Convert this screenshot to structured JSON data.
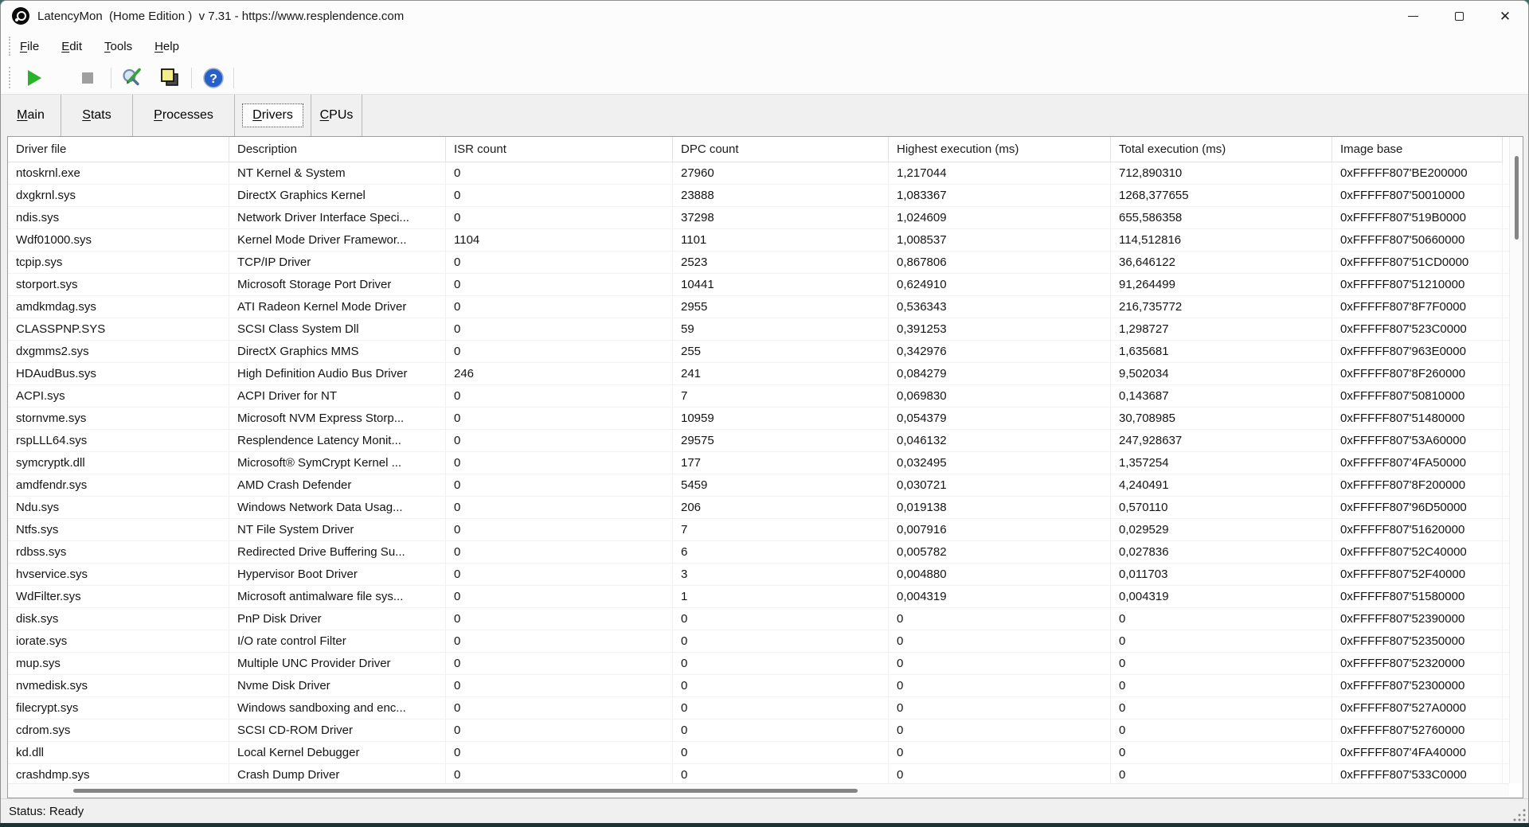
{
  "window": {
    "title": "LatencyMon  (Home Edition )  v 7.31 - https://www.resplendence.com"
  },
  "menu": {
    "items": [
      "File",
      "Edit",
      "Tools",
      "Help"
    ]
  },
  "toolbar": {
    "icons": {
      "play": "start-monitor",
      "stop": "stop-monitor",
      "options": "edit-options",
      "report": "copy-report",
      "help": "help"
    },
    "colors": {
      "play_green": "#28b428",
      "stop_gray": "#9f9f9f",
      "report_yellow": "#f2ec8c",
      "help_blue": "#2760c9"
    }
  },
  "tabs": [
    {
      "label": "Main",
      "active": false
    },
    {
      "label": "Stats",
      "active": false
    },
    {
      "label": "Processes",
      "active": false
    },
    {
      "label": "Drivers",
      "active": true
    },
    {
      "label": "CPUs",
      "active": false
    }
  ],
  "table": {
    "columns": [
      "Driver file",
      "Description",
      "ISR count",
      "DPC count",
      "Highest execution (ms)",
      "Total execution (ms)",
      "Image base"
    ],
    "rows": [
      [
        "ntoskrnl.exe",
        "NT Kernel & System",
        "0",
        "27960",
        "1,217044",
        "712,890310",
        "0xFFFFF807'BE200000"
      ],
      [
        "dxgkrnl.sys",
        "DirectX Graphics Kernel",
        "0",
        "23888",
        "1,083367",
        "1268,377655",
        "0xFFFFF807'50010000"
      ],
      [
        "ndis.sys",
        "Network Driver Interface Speci...",
        "0",
        "37298",
        "1,024609",
        "655,586358",
        "0xFFFFF807'519B0000"
      ],
      [
        "Wdf01000.sys",
        "Kernel Mode Driver Framewor...",
        "1104",
        "1101",
        "1,008537",
        "114,512816",
        "0xFFFFF807'50660000"
      ],
      [
        "tcpip.sys",
        "TCP/IP Driver",
        "0",
        "2523",
        "0,867806",
        "36,646122",
        "0xFFFFF807'51CD0000"
      ],
      [
        "storport.sys",
        "Microsoft Storage Port Driver",
        "0",
        "10441",
        "0,624910",
        "91,264499",
        "0xFFFFF807'51210000"
      ],
      [
        "amdkmdag.sys",
        "ATI Radeon Kernel Mode Driver",
        "0",
        "2955",
        "0,536343",
        "216,735772",
        "0xFFFFF807'8F7F0000"
      ],
      [
        "CLASSPNP.SYS",
        "SCSI Class System Dll",
        "0",
        "59",
        "0,391253",
        "1,298727",
        "0xFFFFF807'523C0000"
      ],
      [
        "dxgmms2.sys",
        "DirectX Graphics MMS",
        "0",
        "255",
        "0,342976",
        "1,635681",
        "0xFFFFF807'963E0000"
      ],
      [
        "HDAudBus.sys",
        "High Definition Audio Bus Driver",
        "246",
        "241",
        "0,084279",
        "9,502034",
        "0xFFFFF807'8F260000"
      ],
      [
        "ACPI.sys",
        "ACPI Driver for NT",
        "0",
        "7",
        "0,069830",
        "0,143687",
        "0xFFFFF807'50810000"
      ],
      [
        "stornvme.sys",
        "Microsoft NVM Express Storp...",
        "0",
        "10959",
        "0,054379",
        "30,708985",
        "0xFFFFF807'51480000"
      ],
      [
        "rspLLL64.sys",
        "Resplendence Latency Monit...",
        "0",
        "29575",
        "0,046132",
        "247,928637",
        "0xFFFFF807'53A60000"
      ],
      [
        "symcryptk.dll",
        "Microsoft® SymCrypt Kernel ...",
        "0",
        "177",
        "0,032495",
        "1,357254",
        "0xFFFFF807'4FA50000"
      ],
      [
        "amdfendr.sys",
        "AMD Crash Defender",
        "0",
        "5459",
        "0,030721",
        "4,240491",
        "0xFFFFF807'8F200000"
      ],
      [
        "Ndu.sys",
        "Windows Network Data Usag...",
        "0",
        "206",
        "0,019138",
        "0,570110",
        "0xFFFFF807'96D50000"
      ],
      [
        "Ntfs.sys",
        "NT File System Driver",
        "0",
        "7",
        "0,007916",
        "0,029529",
        "0xFFFFF807'51620000"
      ],
      [
        "rdbss.sys",
        "Redirected Drive Buffering Su...",
        "0",
        "6",
        "0,005782",
        "0,027836",
        "0xFFFFF807'52C40000"
      ],
      [
        "hvservice.sys",
        "Hypervisor Boot Driver",
        "0",
        "3",
        "0,004880",
        "0,011703",
        "0xFFFFF807'52F40000"
      ],
      [
        "WdFilter.sys",
        "Microsoft antimalware file sys...",
        "0",
        "1",
        "0,004319",
        "0,004319",
        "0xFFFFF807'51580000"
      ],
      [
        "disk.sys",
        "PnP Disk Driver",
        "0",
        "0",
        "0",
        "0",
        "0xFFFFF807'52390000"
      ],
      [
        "iorate.sys",
        "I/O rate control Filter",
        "0",
        "0",
        "0",
        "0",
        "0xFFFFF807'52350000"
      ],
      [
        "mup.sys",
        "Multiple UNC Provider Driver",
        "0",
        "0",
        "0",
        "0",
        "0xFFFFF807'52320000"
      ],
      [
        "nvmedisk.sys",
        "Nvme Disk Driver",
        "0",
        "0",
        "0",
        "0",
        "0xFFFFF807'52300000"
      ],
      [
        "filecrypt.sys",
        "Windows sandboxing and enc...",
        "0",
        "0",
        "0",
        "0",
        "0xFFFFF807'527A0000"
      ],
      [
        "cdrom.sys",
        "SCSI CD-ROM Driver",
        "0",
        "0",
        "0",
        "0",
        "0xFFFFF807'52760000"
      ],
      [
        "kd.dll",
        "Local Kernel Debugger",
        "0",
        "0",
        "0",
        "0",
        "0xFFFFF807'4FA40000"
      ],
      [
        "crashdmp.sys",
        "Crash Dump Driver",
        "0",
        "0",
        "0",
        "0",
        "0xFFFFF807'533C0000"
      ]
    ]
  },
  "status": {
    "text": "Status: Ready"
  }
}
